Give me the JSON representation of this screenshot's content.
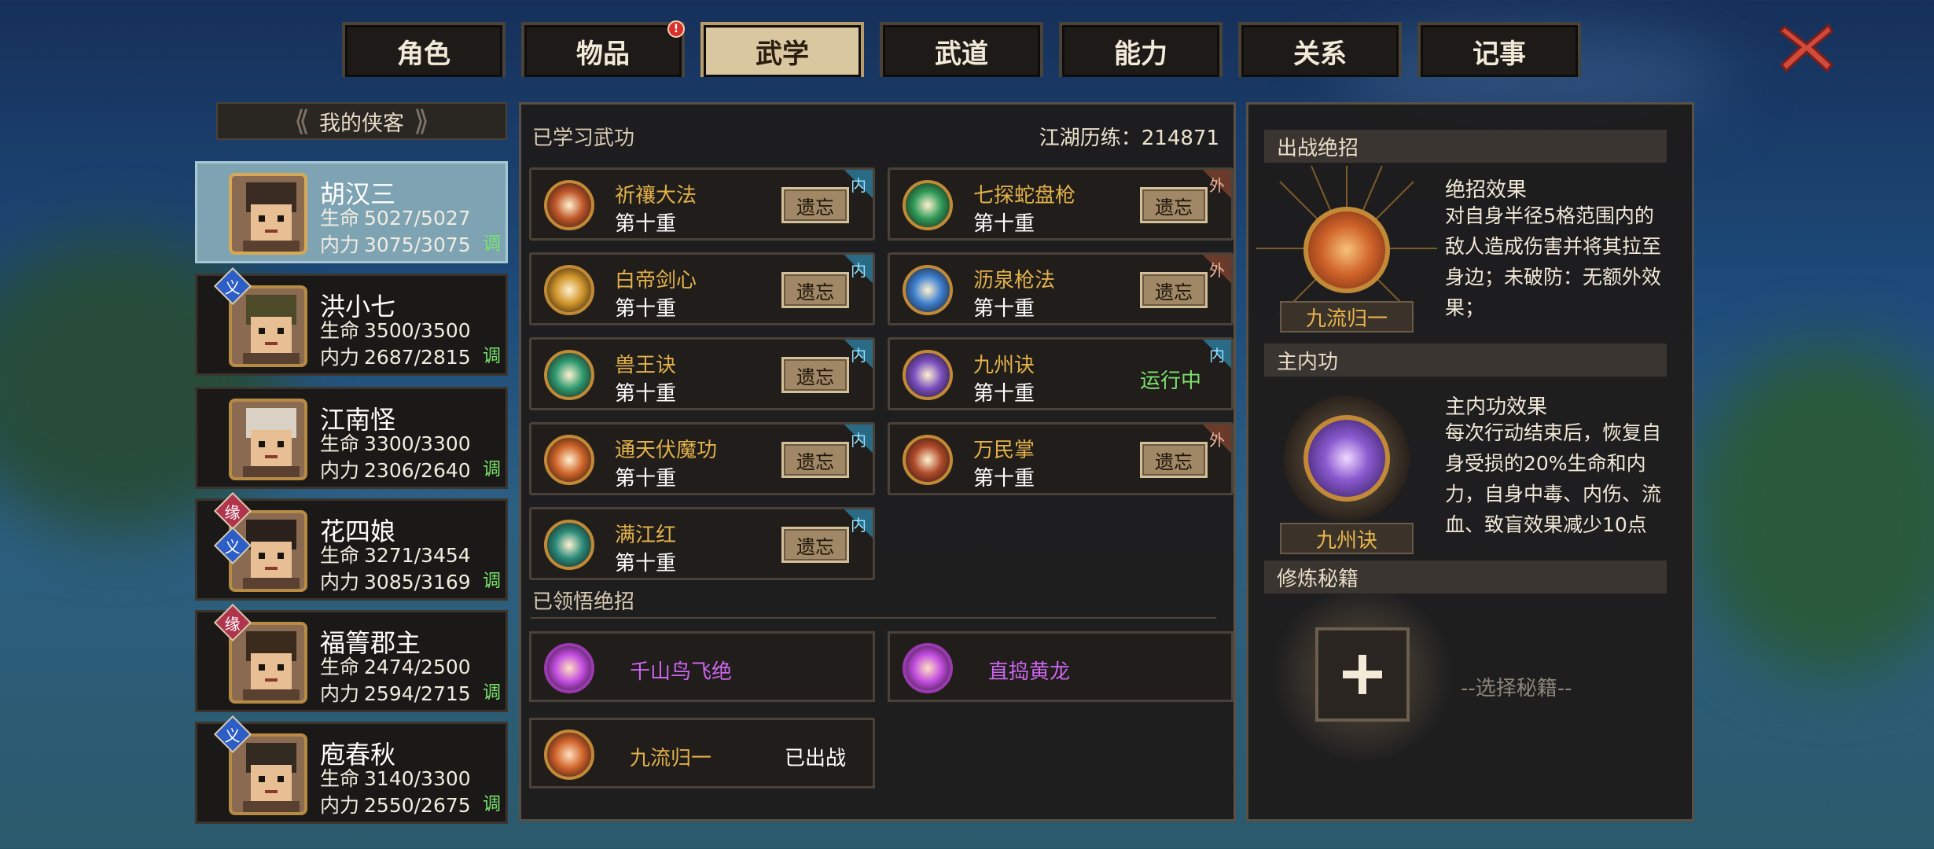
{
  "tabs": [
    {
      "label": "角色",
      "active": false,
      "alert": false
    },
    {
      "label": "物品",
      "active": false,
      "alert": true
    },
    {
      "label": "武学",
      "active": true,
      "alert": false
    },
    {
      "label": "武道",
      "active": false,
      "alert": false
    },
    {
      "label": "能力",
      "active": false,
      "alert": false
    },
    {
      "label": "关系",
      "active": false,
      "alert": false
    },
    {
      "label": "记事",
      "active": false,
      "alert": false
    }
  ],
  "alert_mark": "!",
  "roster": {
    "title": "我的侠客",
    "hp_label": "生命",
    "mp_label": "内力",
    "tune_label": "调",
    "heroes": [
      {
        "name": "胡汉三",
        "hp": "5027/5027",
        "mp": "3075/3075",
        "selected": true,
        "badges": []
      },
      {
        "name": "洪小七",
        "hp": "3500/3500",
        "mp": "2687/2815",
        "selected": false,
        "badges": [
          "义"
        ]
      },
      {
        "name": "江南怪",
        "hp": "3300/3300",
        "mp": "2306/2640",
        "selected": false,
        "badges": []
      },
      {
        "name": "花四娘",
        "hp": "3271/3454",
        "mp": "3085/3169",
        "selected": false,
        "badges": [
          "缘",
          "义"
        ]
      },
      {
        "name": "福箐郡主",
        "hp": "2474/2500",
        "mp": "2594/2715",
        "selected": false,
        "badges": [
          "缘"
        ]
      },
      {
        "name": "庖春秋",
        "hp": "3140/3300",
        "mp": "2550/2675",
        "selected": false,
        "badges": [
          "义"
        ]
      }
    ]
  },
  "learned": {
    "title": "已学习武功",
    "exp_label": "江湖历练：",
    "exp_value": "214871",
    "forget_label": "遗忘",
    "running_label": "运行中",
    "skills": [
      {
        "name": "祈禳大法",
        "level": "第十重",
        "tag": "内",
        "color": "#c0562a",
        "running": false
      },
      {
        "name": "七探蛇盘枪",
        "level": "第十重",
        "tag": "外",
        "color": "#2f9a58",
        "running": false
      },
      {
        "name": "白帝剑心",
        "level": "第十重",
        "tag": "内",
        "color": "#d0942a",
        "running": false
      },
      {
        "name": "沥泉枪法",
        "level": "第十重",
        "tag": "外",
        "color": "#3d7fd0",
        "running": false
      },
      {
        "name": "兽王诀",
        "level": "第十重",
        "tag": "内",
        "color": "#2f9a70",
        "running": false
      },
      {
        "name": "九州诀",
        "level": "第十重",
        "tag": "内",
        "color": "#7a4ec0",
        "running": true
      },
      {
        "name": "通天伏魔功",
        "level": "第十重",
        "tag": "内",
        "color": "#d0642a",
        "running": false
      },
      {
        "name": "万民掌",
        "level": "第十重",
        "tag": "外",
        "color": "#b04a2a",
        "running": false
      },
      {
        "name": "满江红",
        "level": "第十重",
        "tag": "内",
        "color": "#2a8a7a",
        "running": false
      }
    ]
  },
  "ultimates": {
    "title": "已领悟绝招",
    "deployed_label": "已出战",
    "items": [
      {
        "name": "千山鸟飞绝",
        "color": "#c24de0",
        "name_color": "#cc66f0",
        "deployed": false
      },
      {
        "name": "直捣黄龙",
        "color": "#c24de0",
        "name_color": "#cc66f0",
        "deployed": false
      },
      {
        "name": "九流归一",
        "color": "#d0642a",
        "name_color": "#e2b14a",
        "deployed": true
      }
    ]
  },
  "right": {
    "battle": {
      "header": "出战绝招",
      "icon_label": "九流归一",
      "effect_title": "绝招效果",
      "effect_text": "对自身半径5格范围内的敌人造成伤害并将其拉至身边；未破防：无额外效果；"
    },
    "inner": {
      "header": "主内功",
      "icon_label": "九州诀",
      "effect_title": "主内功效果",
      "effect_text": "每次行动结束后，恢复自身受损的20%生命和内力，自身中毒、内伤、流血、致盲效果减少10点"
    },
    "manual": {
      "header": "修炼秘籍",
      "placeholder": "--选择秘籍--"
    }
  }
}
